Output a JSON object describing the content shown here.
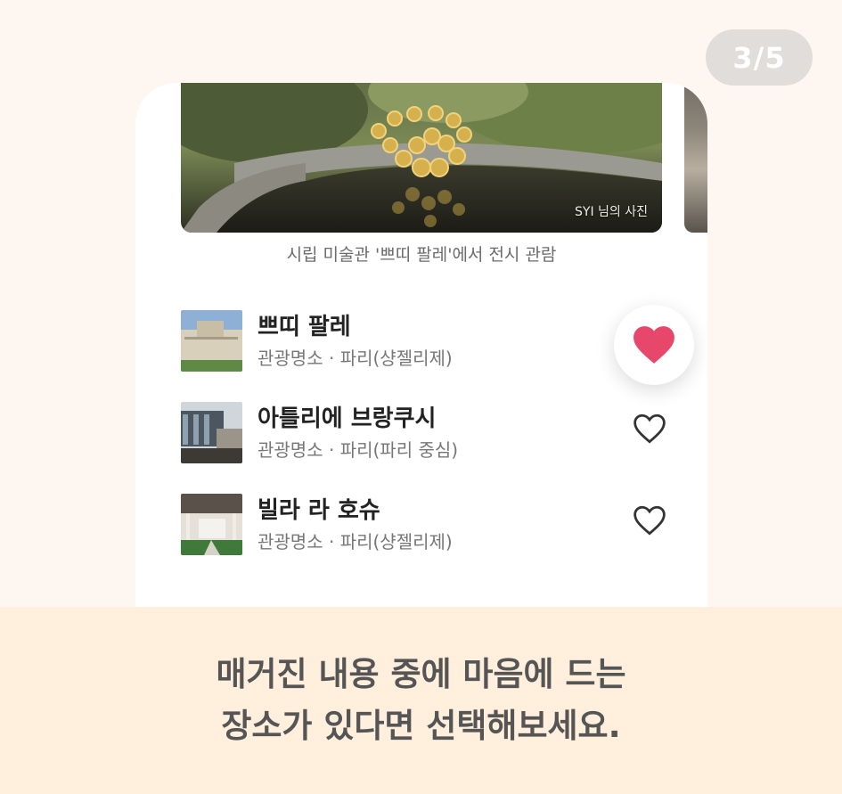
{
  "page_indicator": "3/5",
  "hero": {
    "credit": "SYI 님의 사진",
    "caption": "시립 미술관 '쁘띠 팔레'에서 전시 관람"
  },
  "places": [
    {
      "name": "쁘띠 팔레",
      "category": "관광명소",
      "sep": " · ",
      "location": "파리(샹젤리제)",
      "liked": true
    },
    {
      "name": "아틀리에 브랑쿠시",
      "category": "관광명소",
      "sep": " · ",
      "location": "파리(파리 중심)",
      "liked": false
    },
    {
      "name": "빌라 라 호슈",
      "category": "관광명소",
      "sep": " · ",
      "location": "파리(샹젤리제)",
      "liked": false
    }
  ],
  "instruction": {
    "line1": "매거진 내용 중에 마음에 드는",
    "line2": "장소가 있다면 선택해보세요."
  },
  "colors": {
    "background": "#fef7f1",
    "bottom_band": "#ffefdc",
    "heart_active": "#e8476c",
    "heart_outline": "#333333"
  }
}
